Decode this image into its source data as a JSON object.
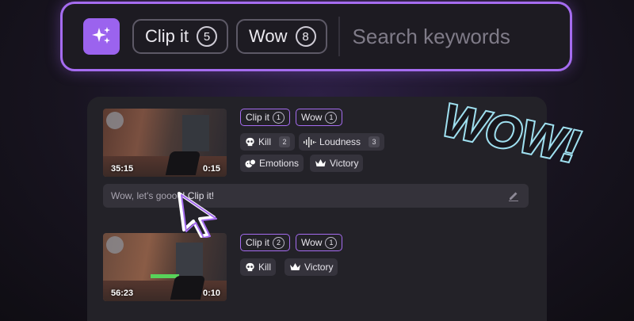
{
  "search_bar": {
    "spark_icon": "sparkles-icon",
    "chips": [
      {
        "label": "Clip it",
        "count": "5"
      },
      {
        "label": "Wow",
        "count": "8"
      }
    ],
    "placeholder": "Search keywords"
  },
  "results": [
    {
      "video": {
        "left_time": "35:15",
        "right_time": "0:15"
      },
      "keyword_tags": [
        {
          "label": "Clip it",
          "count": "1"
        },
        {
          "label": "Wow",
          "count": "1"
        }
      ],
      "event_tags": [
        {
          "icon": "skull-icon",
          "label": "Kill",
          "count": "2"
        },
        {
          "icon": "waveform-icon",
          "label": "Loudness",
          "count": "3"
        },
        {
          "icon": "emotions-icon",
          "label": "Emotions"
        },
        {
          "icon": "crown-icon",
          "label": "Victory"
        }
      ],
      "comment": {
        "prefix": "Wow, let's goooo",
        "suffix": "! Clip it!",
        "icon": "edit-pencil-icon"
      }
    },
    {
      "video": {
        "left_time": "56:23",
        "right_time": "0:10"
      },
      "keyword_tags": [
        {
          "label": "Clip it",
          "count": "2"
        },
        {
          "label": "Wow",
          "count": "1"
        }
      ],
      "event_tags": [
        {
          "icon": "skull-icon",
          "label": "Kill"
        },
        {
          "icon": "crown-icon",
          "label": "Victory"
        }
      ]
    }
  ],
  "overlay": {
    "text": "WOW!",
    "cursor_icon": "mouse-cursor-icon"
  },
  "colors": {
    "accent": "#a56cf0",
    "panel": "#232228",
    "background": "#181420"
  }
}
